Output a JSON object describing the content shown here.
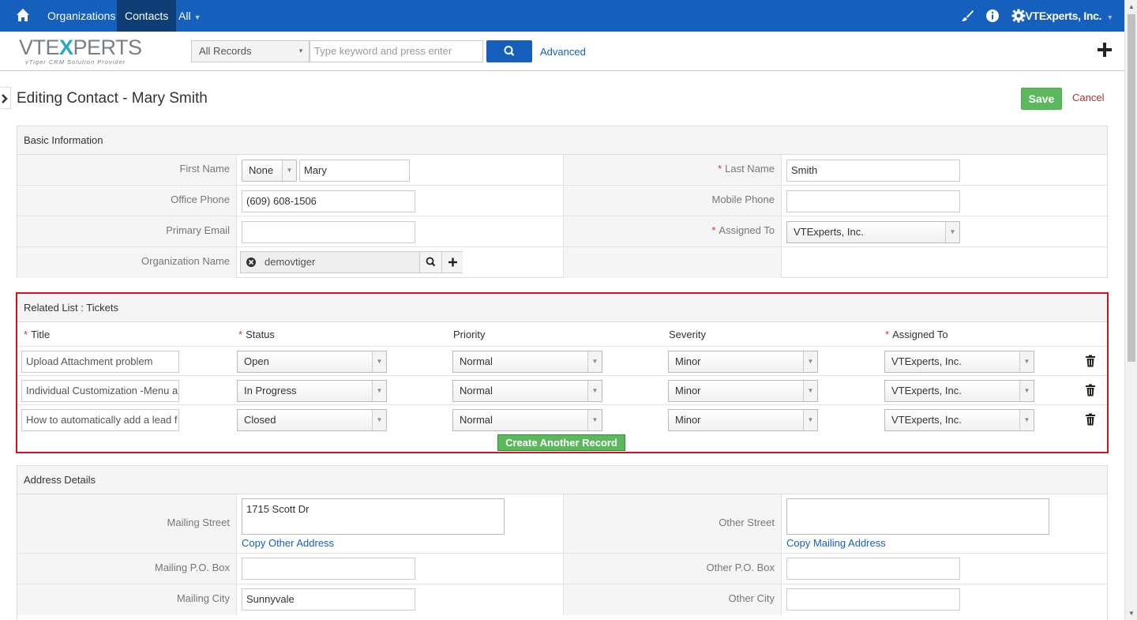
{
  "nav": {
    "items": [
      "Organizations",
      "Contacts",
      "All"
    ],
    "user": "VTExperts, Inc."
  },
  "logo": {
    "big_left": "VTE",
    "big_x": "X",
    "big_right": "PERTS",
    "tagline": "vTiger CRM Solution Provider"
  },
  "search": {
    "scope": "All Records",
    "placeholder": "Type keyword and press enter",
    "advanced": "Advanced"
  },
  "page": {
    "title": "Editing Contact - Mary Smith",
    "save": "Save",
    "cancel": "Cancel"
  },
  "basic": {
    "heading": "Basic Information",
    "first_name_label": "First Name",
    "salutation": "None",
    "first_name": "Mary",
    "last_name_label": "Last Name",
    "last_name": "Smith",
    "office_phone_label": "Office Phone",
    "office_phone": "(609) 608-1506",
    "mobile_phone_label": "Mobile Phone",
    "mobile_phone": "",
    "primary_email_label": "Primary Email",
    "primary_email": "",
    "assigned_to_label": "Assigned To",
    "assigned_to": "VTExperts, Inc.",
    "org_label": "Organization Name",
    "org": "demovtiger"
  },
  "related": {
    "heading": "Related List : Tickets",
    "columns": [
      "Title",
      "Status",
      "Priority",
      "Severity",
      "Assigned To"
    ],
    "rows": [
      {
        "title": "Upload Attachment problem",
        "status": "Open",
        "priority": "Normal",
        "severity": "Minor",
        "assigned": "VTExperts, Inc."
      },
      {
        "title": "Individual Customization -Menu a",
        "status": "In Progress",
        "priority": "Normal",
        "severity": "Minor",
        "assigned": "VTExperts, Inc."
      },
      {
        "title": "How to automatically add a lead f",
        "status": "Closed",
        "priority": "Normal",
        "severity": "Minor",
        "assigned": "VTExperts, Inc."
      }
    ],
    "create_label": "Create Another Record"
  },
  "address": {
    "heading": "Address Details",
    "mailing_street_label": "Mailing Street",
    "mailing_street": "1715 Scott Dr",
    "copy_other": "Copy Other Address",
    "other_street_label": "Other Street",
    "other_street": "",
    "copy_mailing": "Copy Mailing Address",
    "mailing_po_label": "Mailing P.O. Box",
    "mailing_po": "",
    "other_po_label": "Other P.O. Box",
    "other_po": "",
    "mailing_city_label": "Mailing City",
    "mailing_city": "Sunnyvale",
    "other_city_label": "Other City",
    "other_city": ""
  },
  "colors": {
    "navbar": "#1560bd",
    "save": "#5cb85c",
    "highlight_border": "#d0161c"
  }
}
